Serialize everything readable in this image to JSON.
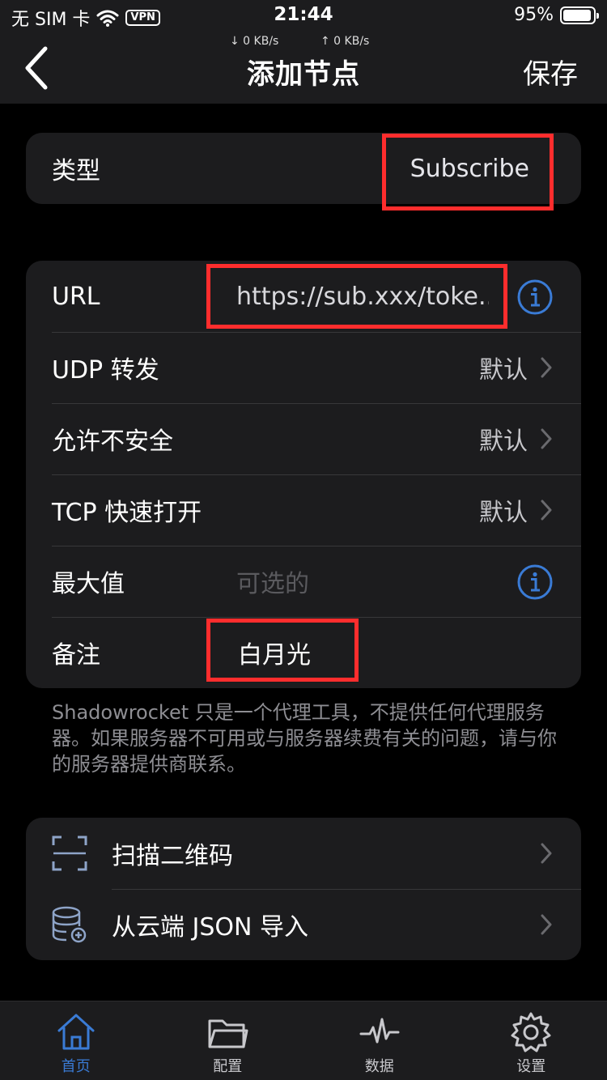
{
  "status_bar": {
    "carrier": "无 SIM 卡",
    "vpn": "VPN",
    "time": "21:44",
    "battery": "95%",
    "battery_level": 0.95
  },
  "nav": {
    "speed_down": "↓ 0 KB/s",
    "speed_up": "↑ 0 KB/s",
    "title": "添加节点",
    "save_label": "保存"
  },
  "type_row": {
    "label": "类型",
    "value": "Subscribe"
  },
  "form": {
    "url": {
      "label": "URL",
      "value": "https://sub.xxx/toke..."
    },
    "udp": {
      "label": "UDP 转发",
      "value": "默认"
    },
    "insecure": {
      "label": "允许不安全",
      "value": "默认"
    },
    "tcp_fast_open": {
      "label": "TCP 快速打开",
      "value": "默认"
    },
    "max": {
      "label": "最大值",
      "placeholder": "可选的"
    },
    "note": {
      "label": "备注",
      "value": "白月光"
    }
  },
  "footnote": "Shadowrocket 只是一个代理工具，不提供任何代理服务器。如果服务器不可用或与服务器续费有关的问题，请与你的服务器提供商联系。",
  "actions": [
    {
      "label": "扫描二维码",
      "icon": "qr-scan-icon"
    },
    {
      "label": "从云端 JSON 导入",
      "icon": "database-add-icon"
    }
  ],
  "tabs": [
    {
      "label": "首页",
      "icon": "home-icon",
      "active": true
    },
    {
      "label": "配置",
      "icon": "folder-icon",
      "active": false
    },
    {
      "label": "数据",
      "icon": "pulse-icon",
      "active": false
    },
    {
      "label": "设置",
      "icon": "gear-icon",
      "active": false
    }
  ],
  "colors": {
    "accent": "#3a7bd5",
    "highlight": "#ff2d2d",
    "background": "#000000",
    "cell": "#1c1c1e"
  }
}
